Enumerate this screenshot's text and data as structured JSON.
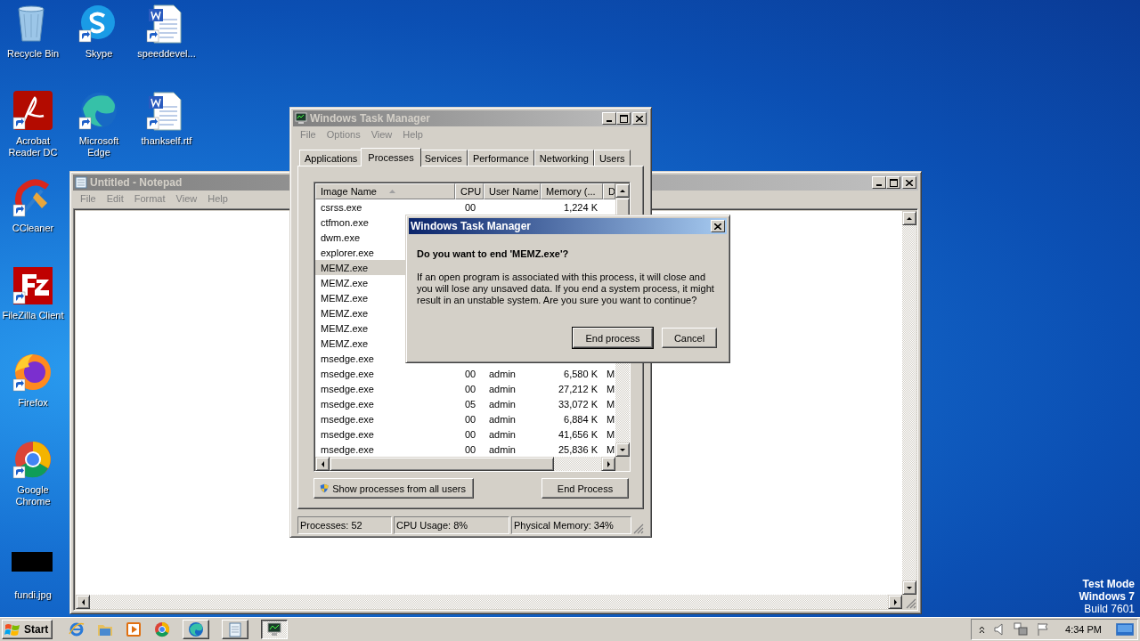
{
  "desktop": {
    "icons": [
      {
        "label": "Recycle Bin"
      },
      {
        "label": "Skype"
      },
      {
        "label": "speeddevel..."
      },
      {
        "label": "Acrobat Reader DC"
      },
      {
        "label": "Microsoft Edge"
      },
      {
        "label": "thankself.rtf"
      },
      {
        "label": "CCleaner"
      },
      {
        "label": "FileZilla Client"
      },
      {
        "label": "Firefox"
      },
      {
        "label": "Google Chrome"
      },
      {
        "label": "fundi.jpg"
      }
    ],
    "os_notice": [
      "Test Mode",
      "Windows 7",
      "Build 7601"
    ]
  },
  "notepad": {
    "title": "Untitled - Notepad",
    "menu": [
      "File",
      "Edit",
      "Format",
      "View",
      "Help"
    ]
  },
  "task_manager": {
    "title": "Windows Task Manager",
    "menu": [
      "File",
      "Options",
      "View",
      "Help"
    ],
    "tabs": [
      {
        "label": "Applications",
        "selected": false
      },
      {
        "label": "Processes",
        "selected": true
      },
      {
        "label": "Services",
        "selected": false
      },
      {
        "label": "Performance",
        "selected": false
      },
      {
        "label": "Networking",
        "selected": false
      },
      {
        "label": "Users",
        "selected": false
      }
    ],
    "columns": [
      "Image Name",
      "CPU",
      "User Name",
      "Memory (...",
      "D"
    ],
    "rows": [
      {
        "name": "csrss.exe",
        "cpu": "00",
        "memory": "1,224 K",
        "selected": false
      },
      {
        "name": "ctfmon.exe",
        "selected": false
      },
      {
        "name": "dwm.exe",
        "selected": false
      },
      {
        "name": "explorer.exe",
        "selected": false
      },
      {
        "name": "MEMZ.exe",
        "selected": true
      },
      {
        "name": "MEMZ.exe",
        "selected": false
      },
      {
        "name": "MEMZ.exe",
        "selected": false
      },
      {
        "name": "MEMZ.exe",
        "selected": false
      },
      {
        "name": "MEMZ.exe",
        "selected": false
      },
      {
        "name": "MEMZ.exe",
        "selected": false
      },
      {
        "name": "msedge.exe",
        "selected": false
      },
      {
        "name": "msedge.exe",
        "cpu": "00",
        "user": "admin",
        "memory": "6,580 K",
        "description": "M",
        "selected": false
      },
      {
        "name": "msedge.exe",
        "cpu": "00",
        "user": "admin",
        "memory": "27,212 K",
        "description": "M",
        "selected": false
      },
      {
        "name": "msedge.exe",
        "cpu": "05",
        "user": "admin",
        "memory": "33,072 K",
        "description": "M",
        "selected": false
      },
      {
        "name": "msedge.exe",
        "cpu": "00",
        "user": "admin",
        "memory": "6,884 K",
        "description": "M",
        "selected": false
      },
      {
        "name": "msedge.exe",
        "cpu": "00",
        "user": "admin",
        "memory": "41,656 K",
        "description": "M",
        "selected": false
      },
      {
        "name": "msedge.exe",
        "cpu": "00",
        "user": "admin",
        "memory": "25,836 K",
        "description": "M",
        "selected": false
      }
    ],
    "buttons": [
      "Show processes from all users",
      "End Process"
    ],
    "status_bar": [
      "Processes: 52",
      "CPU Usage: 8%",
      "Physical Memory: 34%"
    ]
  },
  "dialog": {
    "title": "Windows Task Manager",
    "question": "Do you want to end 'MEMZ.exe'?",
    "message": "If an open program is associated with this process, it will close and you will lose any unsaved data. If you end a system process, it might result in an unstable system. Are you sure you want to continue?",
    "buttons": [
      "End process",
      "Cancel"
    ]
  },
  "taskbar": {
    "start": "Start",
    "windows": [
      {
        "selected": false
      },
      {
        "selected": false
      },
      {
        "selected": true
      }
    ],
    "clock": "4:34 PM"
  }
}
